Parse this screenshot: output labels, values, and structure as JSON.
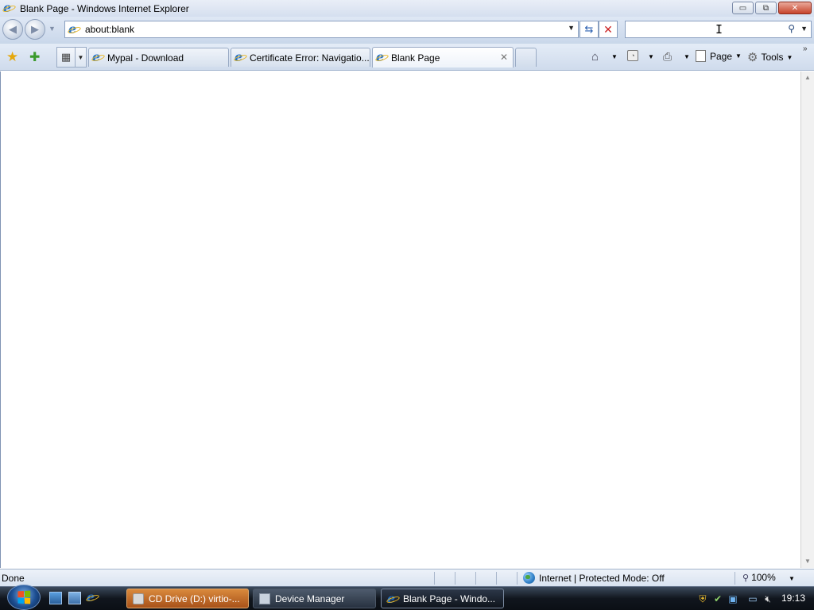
{
  "window": {
    "title": "Blank Page - Windows Internet Explorer",
    "buttons": {
      "minimize": "▭",
      "maximize": "⧉",
      "close": "✕"
    }
  },
  "address_bar": {
    "url": "about:blank"
  },
  "search": {
    "value": "",
    "placeholder": ""
  },
  "tabs": [
    {
      "label": "Mypal - Download",
      "active": false
    },
    {
      "label": "Certificate Error: Navigatio...",
      "active": false
    },
    {
      "label": "Blank Page",
      "active": true
    }
  ],
  "command_bar": {
    "page_label": "Page",
    "tools_label": "Tools"
  },
  "status_bar": {
    "status": "Done",
    "zone": "Internet | Protected Mode: Off",
    "zoom": "100%"
  },
  "taskbar": {
    "items": [
      {
        "label": "CD Drive (D:) virtio-..."
      },
      {
        "label": "Device Manager"
      },
      {
        "label": "Blank Page - Windo..."
      }
    ],
    "clock": "19:13"
  },
  "colors": {
    "accent": "#1f6fc9",
    "titlebar": "#d5dfef",
    "taskbar": "#11161e"
  }
}
